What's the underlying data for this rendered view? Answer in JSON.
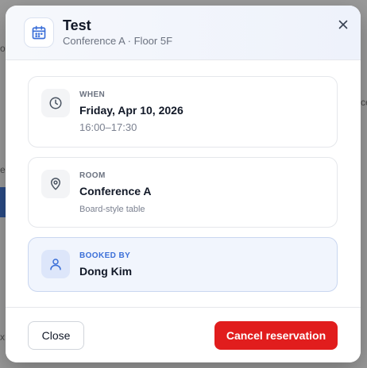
{
  "background": {
    "fragment_chars": [
      "o",
      "ce",
      "e",
      "<",
      "x"
    ]
  },
  "modal": {
    "title": "Test",
    "subtitle": "Conference A · Floor 5F",
    "header_icon": "calendar-icon",
    "close_icon": "close-icon"
  },
  "cards": {
    "when": {
      "icon": "clock-icon",
      "label": "WHEN",
      "date": "Friday, Apr 10, 2026",
      "time": "16:00–17:30"
    },
    "room": {
      "icon": "map-pin-icon",
      "label": "ROOM",
      "name": "Conference A",
      "detail": "Board-style table"
    },
    "booked_by": {
      "icon": "user-icon",
      "label": "BOOKED BY",
      "name": "Dong Kim"
    }
  },
  "footer": {
    "close_label": "Close",
    "cancel_label": "Cancel reservation"
  },
  "colors": {
    "accent_blue": "#3b6fd8",
    "danger": "#e11d1d"
  }
}
